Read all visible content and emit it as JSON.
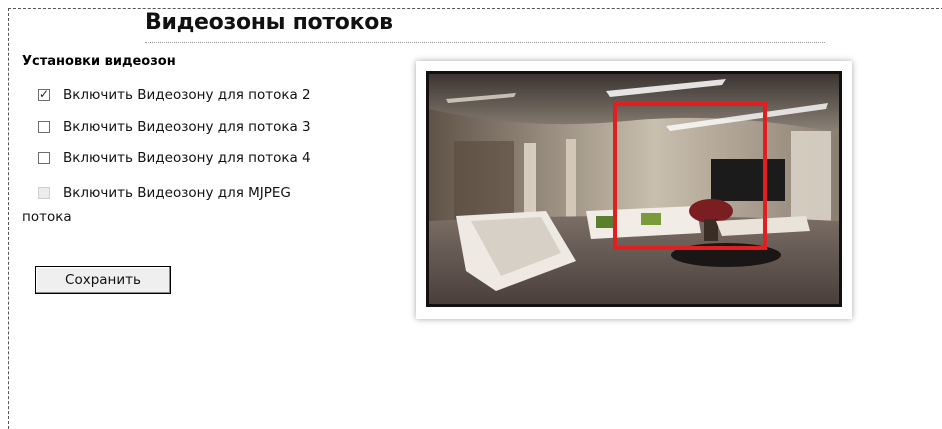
{
  "page": {
    "title": "Видеозоны потоков"
  },
  "section": {
    "label": "Установки видеозон"
  },
  "options": [
    {
      "label": "Включить Видеозону для потока 2",
      "checked": true,
      "disabled": false
    },
    {
      "label": "Включить Видеозону для потока 3",
      "checked": false,
      "disabled": false
    },
    {
      "label": "Включить Видеозону для потока 4",
      "checked": false,
      "disabled": false
    },
    {
      "label": "Включить Видеозону для MJPEG",
      "checked": false,
      "disabled": true,
      "label_cont": "потока"
    }
  ],
  "actions": {
    "save_label": "Сохранить"
  },
  "colors": {
    "zone_rect": "#e02020",
    "frame_border": "#555555"
  },
  "icons": {
    "check": "checkmark-icon"
  }
}
